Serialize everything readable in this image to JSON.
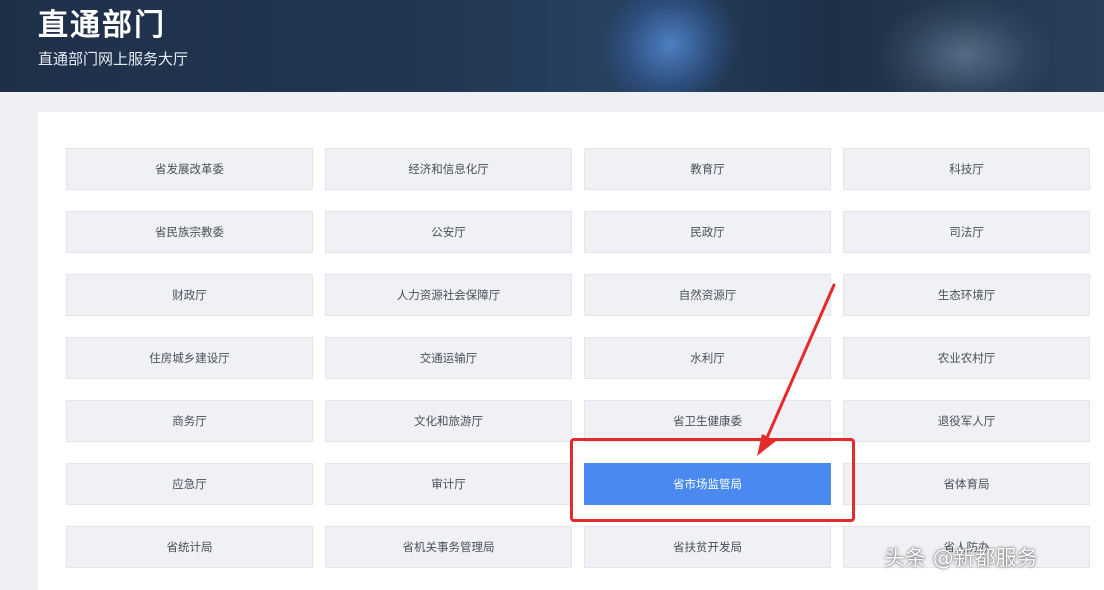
{
  "header": {
    "title": "直通部门",
    "subtitle": "直通部门网上服务大厅"
  },
  "departments": [
    [
      "省发展改革委",
      "经济和信息化厅",
      "教育厅",
      "科技厅"
    ],
    [
      "省民族宗教委",
      "公安厅",
      "民政厅",
      "司法厅"
    ],
    [
      "财政厅",
      "人力资源社会保障厅",
      "自然资源厅",
      "生态环境厅"
    ],
    [
      "住房城乡建设厅",
      "交通运输厅",
      "水利厅",
      "农业农村厅"
    ],
    [
      "商务厅",
      "文化和旅游厅",
      "省卫生健康委",
      "退役军人厅"
    ],
    [
      "应急厅",
      "审计厅",
      "省市场监管局",
      "省体育局"
    ],
    [
      "省统计局",
      "省机关事务管理局",
      "省扶贫开发局",
      "省人防办"
    ]
  ],
  "selected": "省市场监管局",
  "watermark": "头条 @新都服务",
  "colors": {
    "active": "#4a8af0",
    "highlight": "#e42a2a"
  }
}
